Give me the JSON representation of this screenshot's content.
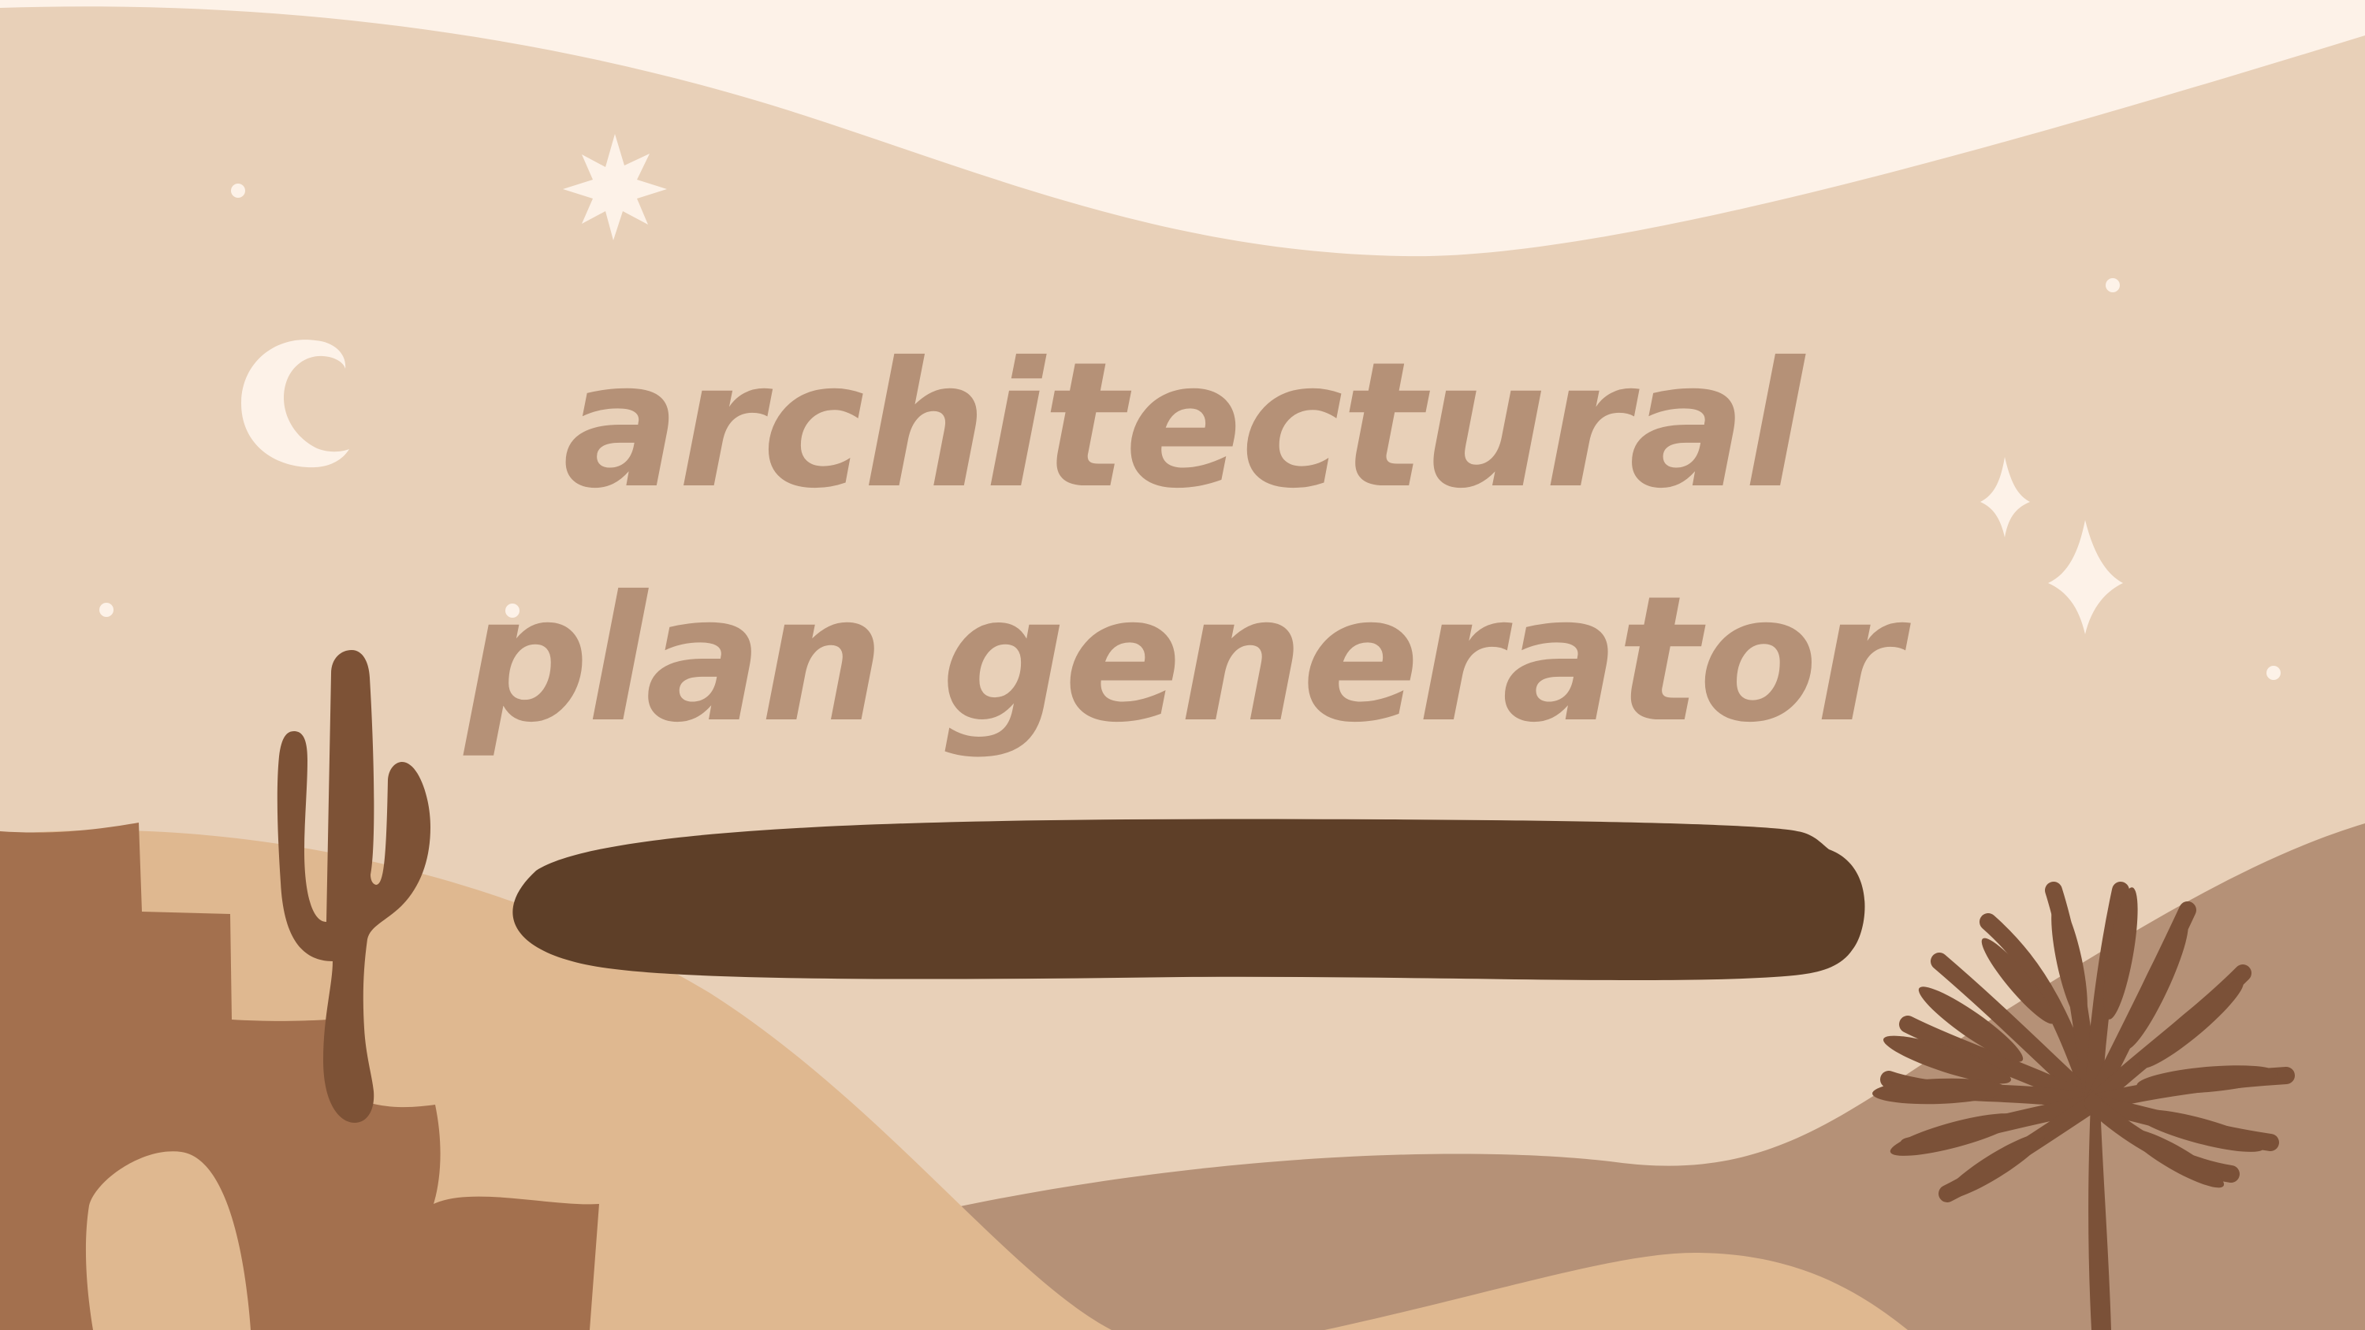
{
  "title": {
    "line1": "architectural",
    "line2": "plan generator"
  },
  "colors": {
    "sky_top": "#FDF2E8",
    "sky": "#E8D0B8",
    "title_text": "#B59177",
    "title_bar": "#5E3F28",
    "dune_light": "#DFB890",
    "dune_mid": "#B59177",
    "mesa": "#A3704E",
    "cactus": "#7D5236",
    "palm": "#7B5138",
    "stars": "#FDF2E8"
  },
  "icons": [
    "crescent-moon-icon",
    "starburst-icon",
    "sparkle-icon",
    "cactus-icon",
    "palm-tree-icon"
  ]
}
